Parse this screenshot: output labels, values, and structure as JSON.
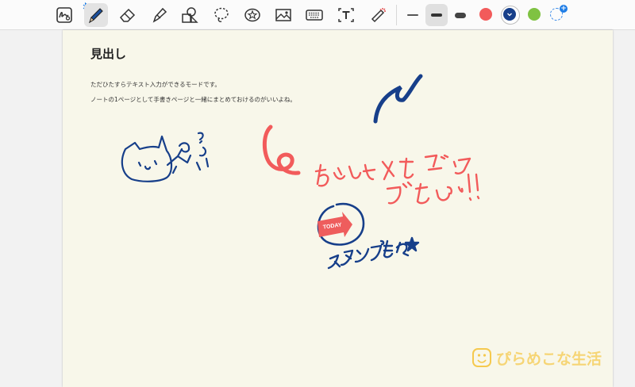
{
  "toolbar": {
    "tools": [
      {
        "name": "pen-handwriting-mode"
      },
      {
        "name": "pen"
      },
      {
        "name": "eraser"
      },
      {
        "name": "highlighter"
      },
      {
        "name": "shapes"
      },
      {
        "name": "lasso"
      },
      {
        "name": "stamp"
      },
      {
        "name": "image"
      },
      {
        "name": "keyboard"
      },
      {
        "name": "text-box"
      },
      {
        "name": "laser-pointer"
      }
    ],
    "active_tool": "pen",
    "stroke_widths": [
      "thin",
      "medium",
      "thick"
    ],
    "selected_width": "medium",
    "colors": [
      "#f25b5b",
      "#173f8a",
      "#7fc242"
    ],
    "selected_color": "#173f8a",
    "add_color_badge": "+"
  },
  "page": {
    "heading": "見出し",
    "body_lines": [
      "ただひたすらテキスト入力ができるモードです。",
      "ノートの1ページとして手書きページと一緒にまとめておけるのがいいよね。"
    ]
  },
  "stamp": {
    "label": "TODAY"
  },
  "watermark": {
    "text": "ぴらめこな生活"
  }
}
